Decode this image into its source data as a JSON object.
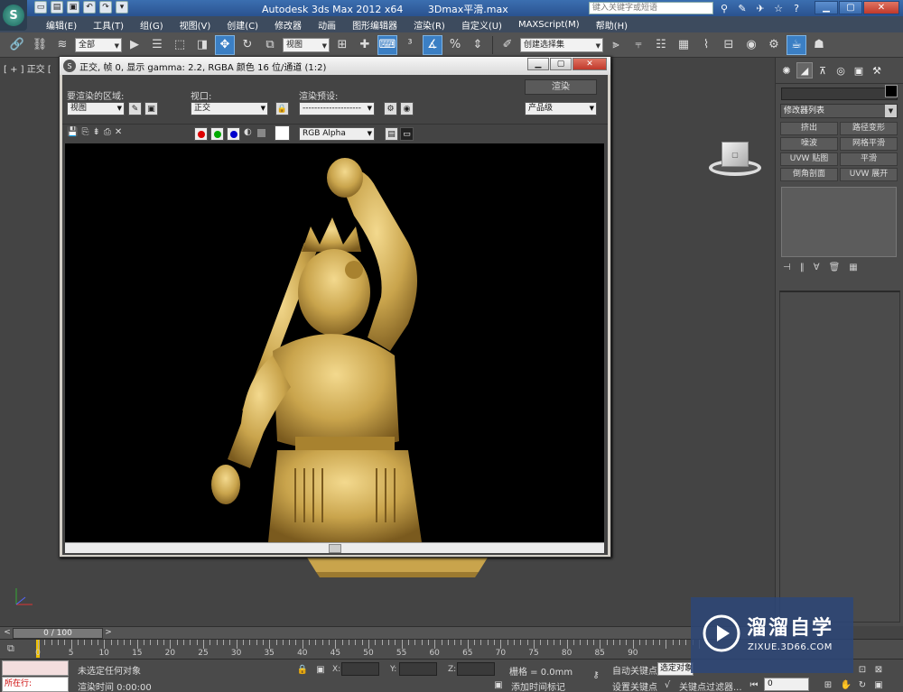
{
  "titlebar": {
    "app_title": "Autodesk 3ds Max  2012 x64",
    "file_name": "3Dmax平滑.max",
    "search_placeholder": "键入关键字或短语"
  },
  "menu": [
    "编辑(E)",
    "工具(T)",
    "组(G)",
    "视图(V)",
    "创建(C)",
    "修改器",
    "动画",
    "图形编辑器",
    "渲染(R)",
    "自定义(U)",
    "MAXScript(M)",
    "帮助(H)"
  ],
  "toolbar": {
    "selection_filter": "全部",
    "ref_coord": "视图",
    "named_selection": "创建选择集"
  },
  "viewport": {
    "label": "[ + ] 正交 ["
  },
  "render_window": {
    "title": "正交, 帧 0, 显示 gamma: 2.2, RGBA 颜色 16 位/通道 (1:2)",
    "area_label": "要渲染的区域:",
    "area_value": "视图",
    "viewport_label": "视口:",
    "viewport_value": "正交",
    "preset_label": "渲染预设:",
    "preset_value": "--------------------",
    "render_button": "渲染",
    "quality_value": "产品级",
    "channel_value": "RGB Alpha"
  },
  "command_panel": {
    "modifier_list": "修改器列表",
    "modifier_buttons": [
      "挤出",
      "路径变形",
      "噪波",
      "网格平滑",
      "UVW 贴图",
      "平滑",
      "倒角剖面",
      "UVW 展开"
    ]
  },
  "time_slider": {
    "position": "0 / 100"
  },
  "track_bar": {
    "ticks": [
      "0",
      "5",
      "10",
      "15",
      "20",
      "25",
      "30",
      "35",
      "40",
      "45",
      "50",
      "55",
      "60",
      "65",
      "70",
      "75",
      "80",
      "85",
      "90"
    ]
  },
  "status": {
    "maxscript_label": "所在行:",
    "selection_status": "未选定任何对象",
    "render_time": "渲染时间  0:00:00",
    "x_label": "X:",
    "y_label": "Y:",
    "z_label": "Z:",
    "grid": "栅格 = 0.0mm",
    "add_time_tag": "添加时间标记",
    "auto_key": "自动关键点",
    "set_key": "设置关键点",
    "selected_dropdown": "选定对象",
    "key_filters": "关键点过滤器...",
    "current_frame": "0"
  },
  "watermark": {
    "title": "溜溜自学",
    "url": "ZIXUE.3D66.COM"
  },
  "colors": {
    "accent_blue": "#3b7fc4",
    "statue_gold": "#c9a44c",
    "time_cursor": "#f0c000"
  }
}
